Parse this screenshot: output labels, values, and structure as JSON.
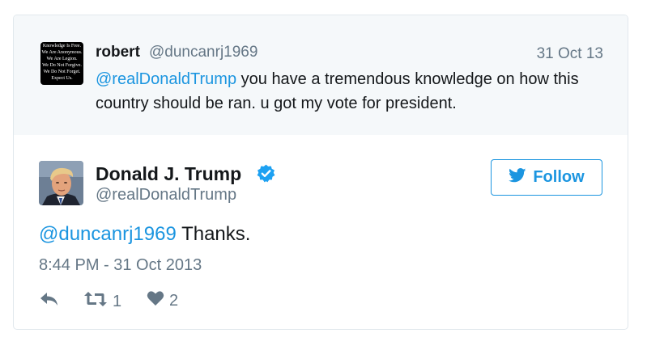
{
  "reply_tweet": {
    "avatar_lines": [
      "Knowledge Is Free.",
      "We Are Anonymous.",
      "We Are Legion.",
      "We Do Not Forgive.",
      "We Do Not Forget.",
      "Expect Us."
    ],
    "name": "robert",
    "handle": "@duncanrj1969",
    "date": "31 Oct 13",
    "mention": "@realDonaldTrump",
    "text": " you have a tremendous knowledge on how this country should be ran. u got my vote for president."
  },
  "main_tweet": {
    "name": "Donald J. Trump",
    "handle": "@realDonaldTrump",
    "follow_label": "Follow",
    "mention": "@duncanrj1969",
    "text": " Thanks.",
    "timestamp": "8:44 PM - 31 Oct 2013",
    "retweet_count": "1",
    "like_count": "2"
  },
  "colors": {
    "link": "#1b95e0",
    "muted": "#657786",
    "reply_bg": "#f5f8fa",
    "border": "#e1e8ed"
  },
  "icons": [
    "verified-badge-icon",
    "twitter-bird-icon",
    "reply-icon",
    "retweet-icon",
    "heart-icon"
  ]
}
